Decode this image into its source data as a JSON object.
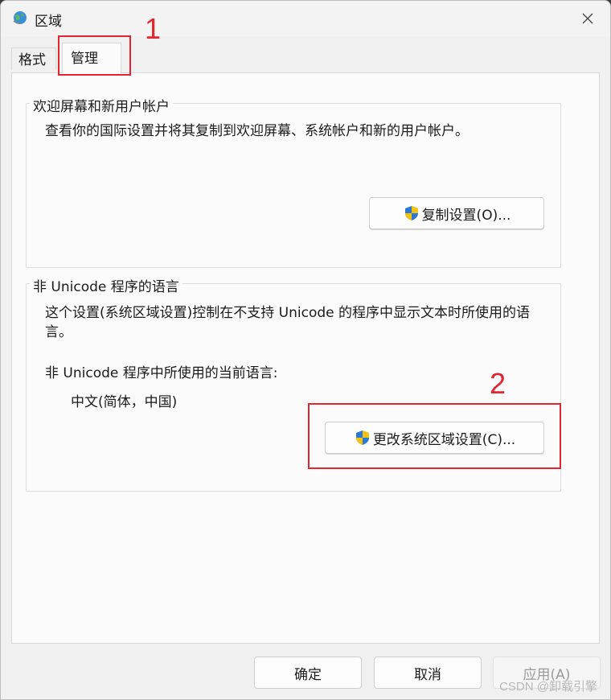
{
  "window": {
    "title": "区域",
    "icon": "globe-icon"
  },
  "tabs": [
    {
      "label": "格式",
      "selected": false
    },
    {
      "label": "管理",
      "selected": true
    }
  ],
  "welcome": {
    "legend": "欢迎屏幕和新用户帐户",
    "description": "查看你的国际设置并将其复制到欢迎屏幕、系统帐户和新的用户帐户。",
    "copy_button": "复制设置(O)..."
  },
  "unicode": {
    "legend": "非 Unicode 程序的语言",
    "description": "这个设置(系统区域设置)控制在不支持 Unicode 的程序中显示文本时所使用的语言。",
    "current_label": "非 Unicode 程序中所使用的当前语言:",
    "current_value": "中文(简体，中国)",
    "change_button": "更改系统区域设置(C)..."
  },
  "footer": {
    "ok": "确定",
    "cancel": "取消",
    "apply": "应用(A)"
  },
  "annotations": {
    "step1": "1",
    "step2": "2",
    "color": "#e0262f"
  },
  "watermark": "CSDN @卸载引擎"
}
